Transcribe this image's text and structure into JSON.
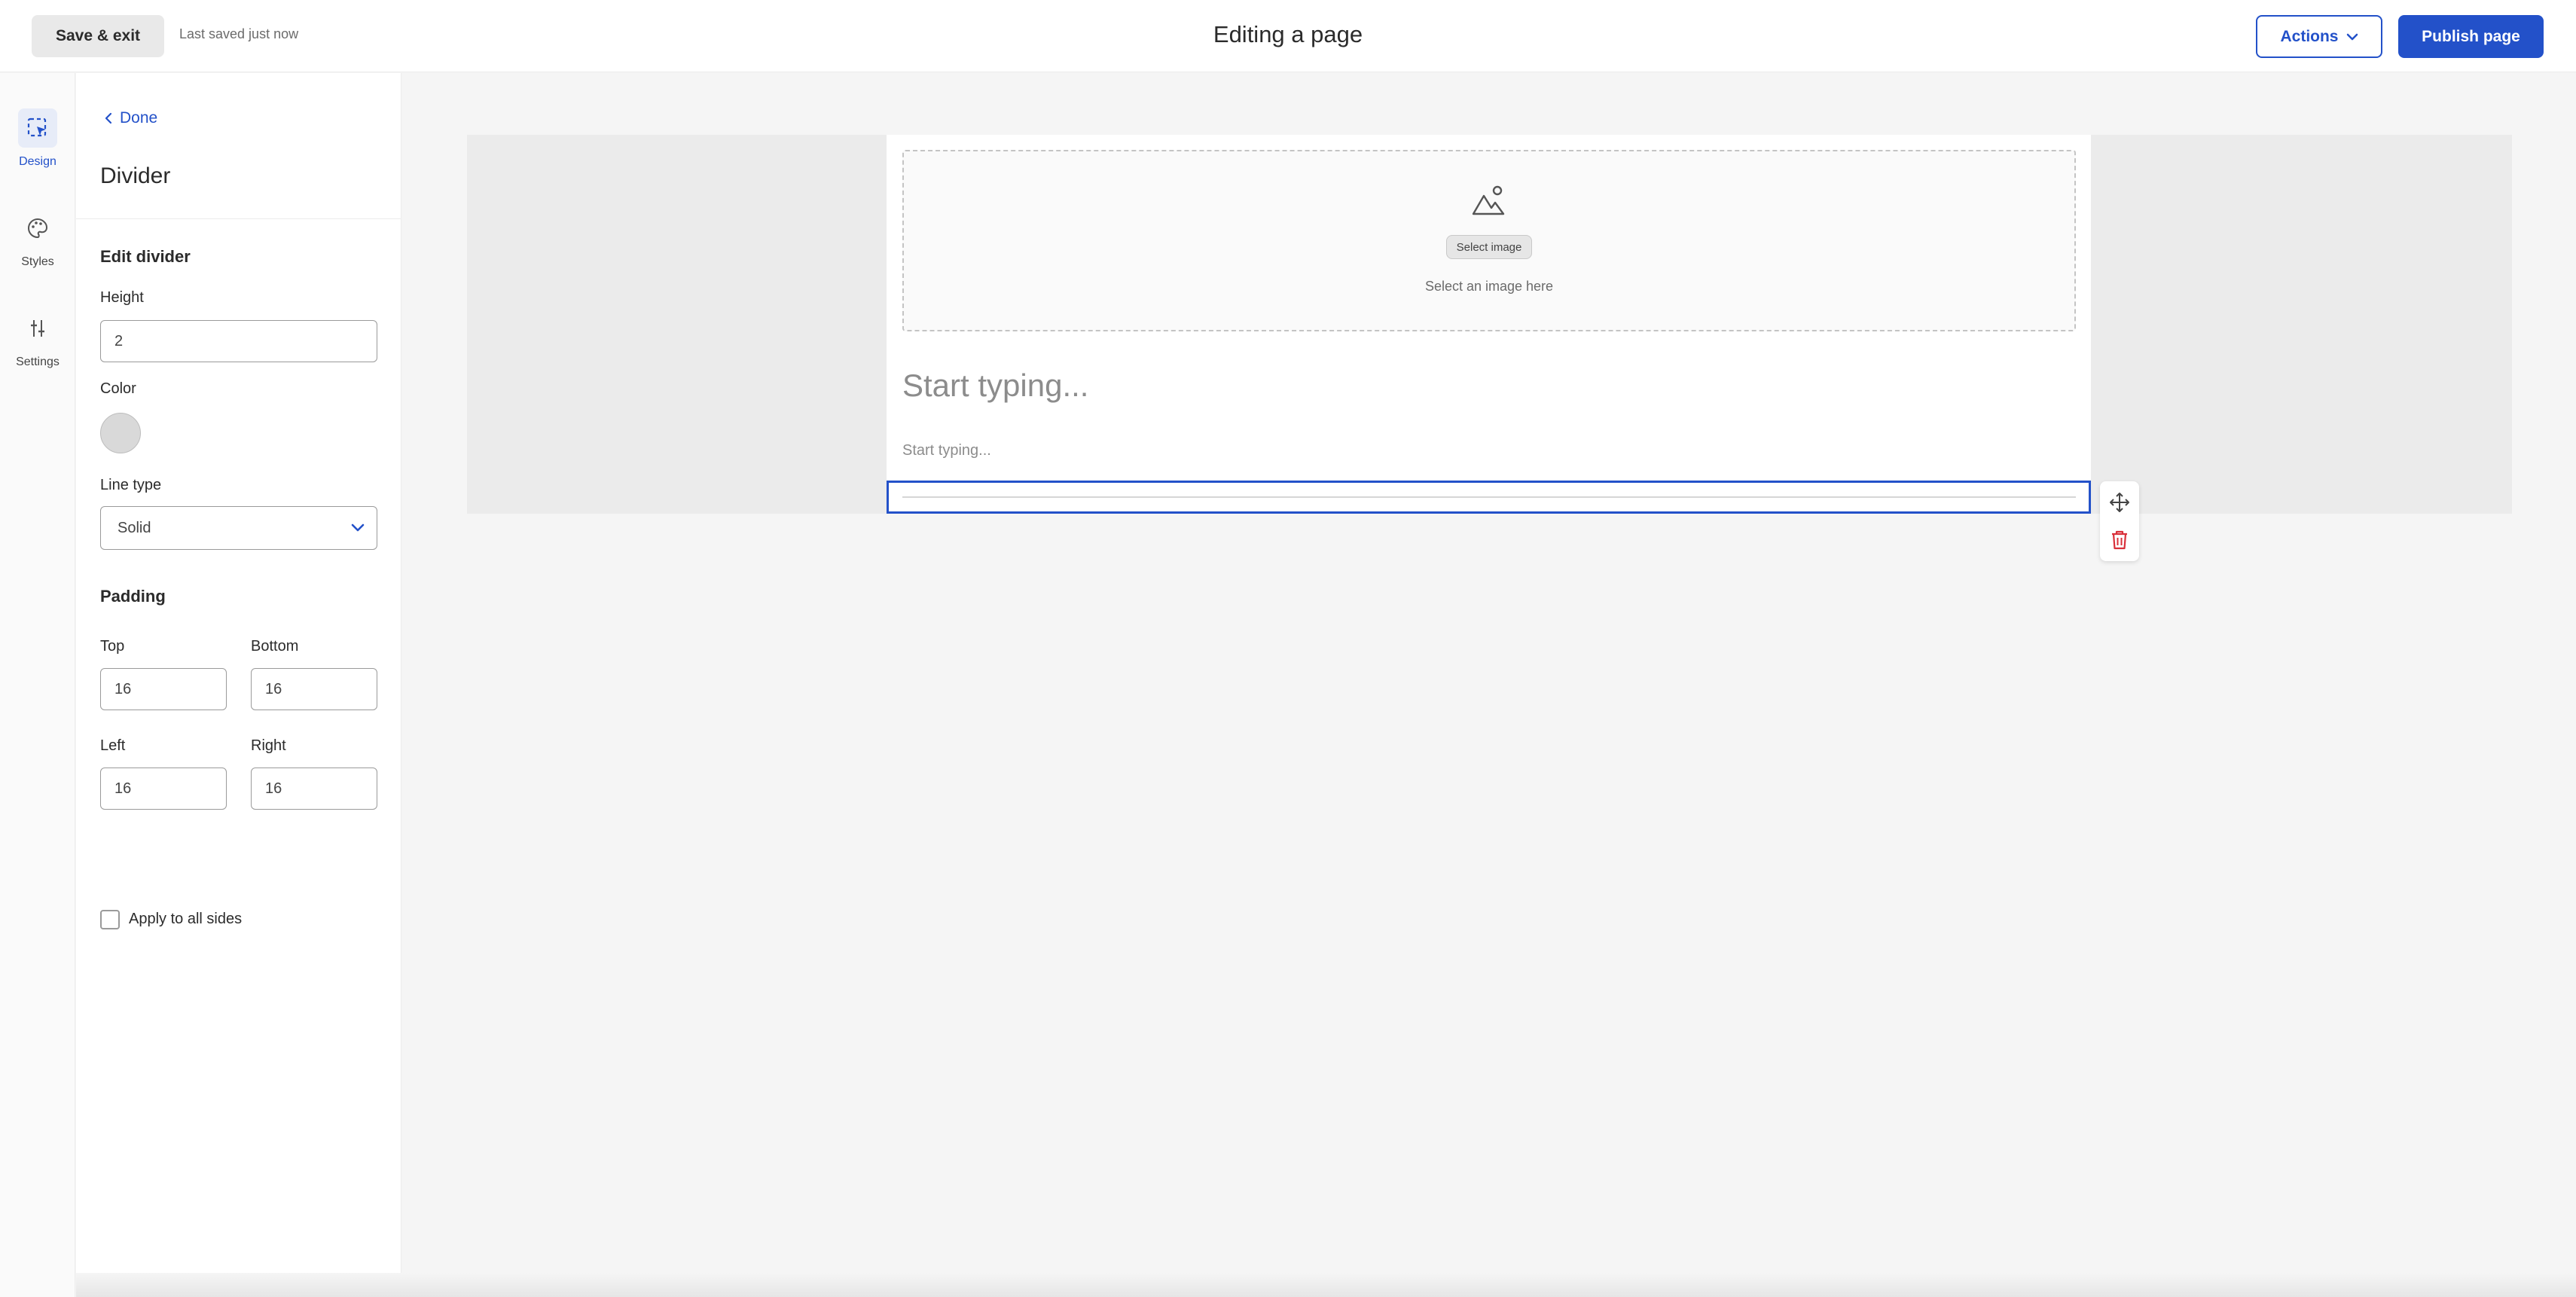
{
  "topbar": {
    "save_exit_label": "Save & exit",
    "last_saved": "Last saved just now",
    "title": "Editing a page",
    "actions_label": "Actions",
    "publish_label": "Publish page"
  },
  "rail": {
    "items": [
      {
        "label": "Design",
        "icon": "design-cursor-icon",
        "active": true
      },
      {
        "label": "Styles",
        "icon": "palette-icon",
        "active": false
      },
      {
        "label": "Settings",
        "icon": "sliders-icon",
        "active": false
      }
    ]
  },
  "panel": {
    "done_label": "Done",
    "title": "Divider",
    "section_label": "Edit divider",
    "height_label": "Height",
    "height_value": "2",
    "color_label": "Color",
    "color_value": "#d9d9d9",
    "line_type_label": "Line type",
    "line_type_value": "Solid",
    "padding_label": "Padding",
    "top_label": "Top",
    "top_value": "16",
    "bottom_label": "Bottom",
    "bottom_value": "16",
    "left_label": "Left",
    "left_value": "16",
    "right_label": "Right",
    "right_value": "16",
    "apply_all_label": "Apply to all sides"
  },
  "canvas": {
    "select_image_button": "Select image",
    "select_image_hint": "Select an image here",
    "heading_placeholder": "Start typing...",
    "paragraph_placeholder": "Start typing..."
  },
  "colors": {
    "accent": "#2351c9",
    "delete": "#d9303a"
  }
}
